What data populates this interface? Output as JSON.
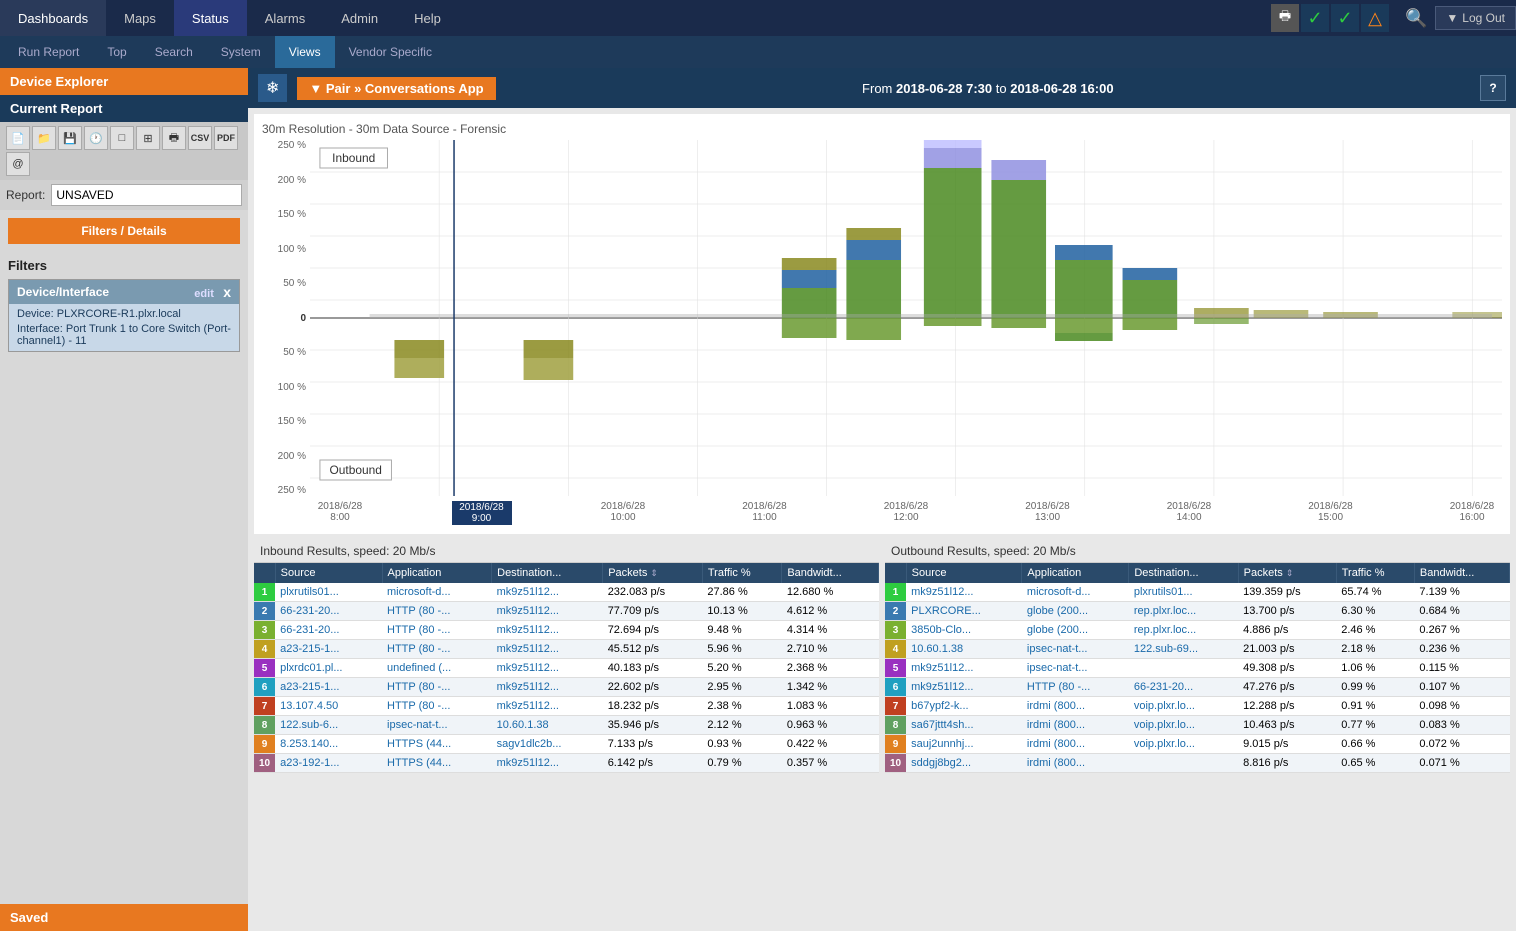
{
  "topNav": {
    "items": [
      {
        "label": "Dashboards",
        "active": false
      },
      {
        "label": "Maps",
        "active": false
      },
      {
        "label": "Status",
        "active": true
      },
      {
        "label": "Alarms",
        "active": false
      },
      {
        "label": "Admin",
        "active": false
      },
      {
        "label": "Help",
        "active": false
      }
    ],
    "logoutLabel": "Log Out"
  },
  "secondNav": {
    "items": [
      {
        "label": "Run Report",
        "active": false
      },
      {
        "label": "Top",
        "active": false
      },
      {
        "label": "Search",
        "active": false
      },
      {
        "label": "System",
        "active": false
      },
      {
        "label": "Views",
        "active": true
      },
      {
        "label": "Vendor Specific",
        "active": false
      }
    ]
  },
  "sidebar": {
    "deviceExplorerLabel": "Device Explorer",
    "currentReportLabel": "Current Report",
    "reportLabel": "Report:",
    "reportValue": "UNSAVED",
    "filtersButtonLabel": "Filters / Details",
    "filtersTitle": "Filters",
    "filterGroup": {
      "title": "Device/Interface",
      "editLabel": "edit",
      "device": "Device: PLXRCORE-R1.plxr.local",
      "interface": "Interface: Port Trunk 1 to Core Switch (Port-channel1) - 11"
    },
    "savedLabel": "Saved"
  },
  "header": {
    "breadcrumb": "▼ Pair » Conversations App",
    "dateRange": "From 2018-06-28 7:30 to 2018-06-28 16:00"
  },
  "chart": {
    "title": "30m Resolution - 30m Data Source - Forensic",
    "inboundLabel": "Inbound",
    "outboundLabel": "Outbound",
    "xLabels": [
      "2018/6/28\n8:00",
      "2018/6/28\n9:00",
      "2018/6/28\n10:00",
      "2018/6/28\n11:00",
      "2018/6/28\n12:00",
      "2018/6/28\n13:00",
      "2018/6/28\n14:00",
      "2018/6/28\n15:00",
      "2018/6/28\n16:00"
    ],
    "yLabelsTop": [
      "250 %",
      "200 %",
      "150 %",
      "100 %",
      "50 %",
      "0"
    ],
    "yLabelsBottom": [
      "50 %",
      "100 %",
      "150 %",
      "200 %",
      "250 %"
    ]
  },
  "inboundTable": {
    "title": "Inbound Results, speed: 20 Mb/s",
    "columns": [
      "Source",
      "Application",
      "Destination...",
      "Packets ⇕",
      "Traffic %",
      "Bandwidt..."
    ],
    "rows": [
      {
        "num": 1,
        "src": "plxrutils01...",
        "app": "microsoft-d...",
        "dst": "mk9z51l12...",
        "pkt": "232.083 p/s",
        "traf": "27.86 %",
        "bw": "12.680 %",
        "rc": "rc-1"
      },
      {
        "num": 2,
        "src": "66-231-20...",
        "app": "HTTP (80 -...",
        "dst": "mk9z51l12...",
        "pkt": "77.709 p/s",
        "traf": "10.13 %",
        "bw": "4.612 %",
        "rc": "rc-2"
      },
      {
        "num": 3,
        "src": "66-231-20...",
        "app": "HTTP (80 -...",
        "dst": "mk9z51l12...",
        "pkt": "72.694 p/s",
        "traf": "9.48 %",
        "bw": "4.314 %",
        "rc": "rc-3"
      },
      {
        "num": 4,
        "src": "a23-215-1...",
        "app": "HTTP (80 -...",
        "dst": "mk9z51l12...",
        "pkt": "45.512 p/s",
        "traf": "5.96 %",
        "bw": "2.710 %",
        "rc": "rc-4"
      },
      {
        "num": 5,
        "src": "plxrdc01.pl...",
        "app": "undefined (...",
        "dst": "mk9z51l12...",
        "pkt": "40.183 p/s",
        "traf": "5.20 %",
        "bw": "2.368 %",
        "rc": "rc-5"
      },
      {
        "num": 6,
        "src": "a23-215-1...",
        "app": "HTTP (80 -...",
        "dst": "mk9z51l12...",
        "pkt": "22.602 p/s",
        "traf": "2.95 %",
        "bw": "1.342 %",
        "rc": "rc-6"
      },
      {
        "num": 7,
        "src": "13.107.4.50",
        "app": "HTTP (80 -...",
        "dst": "mk9z51l12...",
        "pkt": "18.232 p/s",
        "traf": "2.38 %",
        "bw": "1.083 %",
        "rc": "rc-7"
      },
      {
        "num": 8,
        "src": "122.sub-6...",
        "app": "ipsec-nat-t...",
        "dst": "10.60.1.38",
        "pkt": "35.946 p/s",
        "traf": "2.12 %",
        "bw": "0.963 %",
        "rc": "rc-8"
      },
      {
        "num": 9,
        "src": "8.253.140...",
        "app": "HTTPS (44...",
        "dst": "sagv1dlc2b...",
        "pkt": "7.133 p/s",
        "traf": "0.93 %",
        "bw": "0.422 %",
        "rc": "rc-9"
      },
      {
        "num": 10,
        "src": "a23-192-1...",
        "app": "HTTPS (44...",
        "dst": "mk9z51l12...",
        "pkt": "6.142 p/s",
        "traf": "0.79 %",
        "bw": "0.357 %",
        "rc": "rc-10"
      }
    ]
  },
  "outboundTable": {
    "title": "Outbound Results, speed: 20 Mb/s",
    "columns": [
      "Source",
      "Application",
      "Destination...",
      "Packets ⇕",
      "Traffic %",
      "Bandwidt..."
    ],
    "rows": [
      {
        "num": 1,
        "src": "mk9z51l12...",
        "app": "microsoft-d...",
        "dst": "plxrutils01...",
        "pkt": "139.359 p/s",
        "traf": "65.74 %",
        "bw": "7.139 %",
        "rc": "rc-1"
      },
      {
        "num": 2,
        "src": "PLXRCORE...",
        "app": "globe (200...",
        "dst": "rep.plxr.loc...",
        "pkt": "13.700 p/s",
        "traf": "6.30 %",
        "bw": "0.684 %",
        "rc": "rc-2"
      },
      {
        "num": 3,
        "src": "3850b-Clo...",
        "app": "globe (200...",
        "dst": "rep.plxr.loc...",
        "pkt": "4.886 p/s",
        "traf": "2.46 %",
        "bw": "0.267 %",
        "rc": "rc-3"
      },
      {
        "num": 4,
        "src": "10.60.1.38",
        "app": "ipsec-nat-t...",
        "dst": "122.sub-69...",
        "pkt": "21.003 p/s",
        "traf": "2.18 %",
        "bw": "0.236 %",
        "rc": "rc-4"
      },
      {
        "num": 5,
        "src": "mk9z51l12...",
        "app": "ipsec-nat-t...",
        "dst": "",
        "pkt": "49.308 p/s",
        "traf": "1.06 %",
        "bw": "0.115 %",
        "rc": "rc-5"
      },
      {
        "num": 6,
        "src": "mk9z51l12...",
        "app": "HTTP (80 -...",
        "dst": "66-231-20...",
        "pkt": "47.276 p/s",
        "traf": "0.99 %",
        "bw": "0.107 %",
        "rc": "rc-6"
      },
      {
        "num": 7,
        "src": "b67ypf2-k...",
        "app": "irdmi (800...",
        "dst": "voip.plxr.lo...",
        "pkt": "12.288 p/s",
        "traf": "0.91 %",
        "bw": "0.098 %",
        "rc": "rc-7"
      },
      {
        "num": 8,
        "src": "sa67jttt4sh...",
        "app": "irdmi (800...",
        "dst": "voip.plxr.lo...",
        "pkt": "10.463 p/s",
        "traf": "0.77 %",
        "bw": "0.083 %",
        "rc": "rc-8"
      },
      {
        "num": 9,
        "src": "sauj2unnhj...",
        "app": "irdmi (800...",
        "dst": "voip.plxr.lo...",
        "pkt": "9.015 p/s",
        "traf": "0.66 %",
        "bw": "0.072 %",
        "rc": "rc-9"
      },
      {
        "num": 10,
        "src": "sddgj8bg2...",
        "app": "irdmi (800...",
        "dst": "",
        "pkt": "8.816 p/s",
        "traf": "0.65 %",
        "bw": "0.071 %",
        "rc": "rc-10"
      }
    ]
  }
}
